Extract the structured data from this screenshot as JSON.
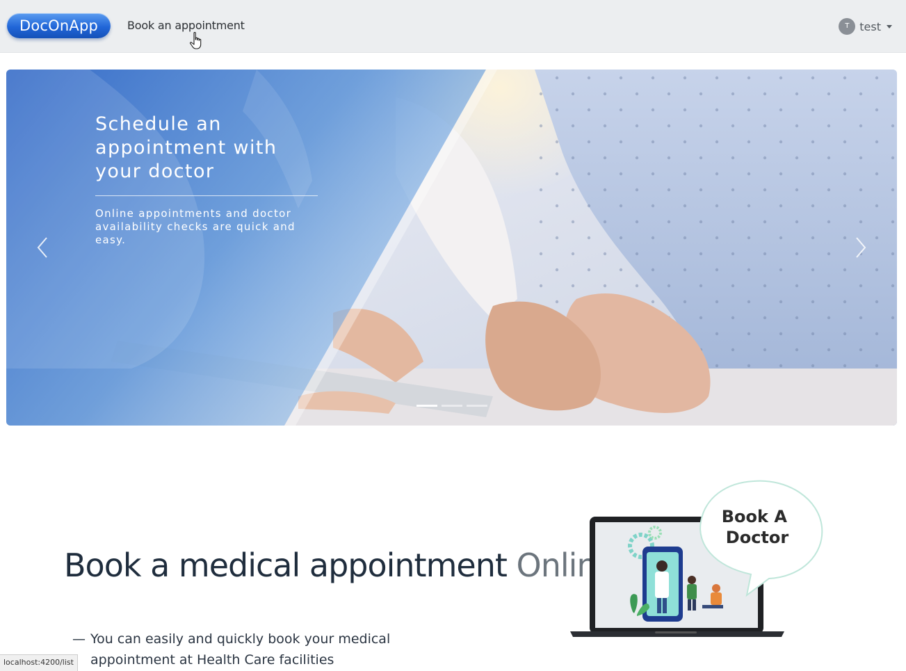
{
  "navbar": {
    "logo": "DocOnApp",
    "link": "Book an appointment",
    "user": {
      "avatar_initial": "T",
      "name": "test"
    }
  },
  "carousel": {
    "slide_count": 3,
    "active_index": 0,
    "slide": {
      "title": "Schedule an appointment with your doctor",
      "text": "Online appointments and doctor availability checks are quick and easy."
    },
    "prev_icon": "chevron-left-icon",
    "next_icon": "chevron-right-icon"
  },
  "hero": {
    "title_main": "Book a medical appointment",
    "title_accent": "Online.",
    "dash": "—",
    "subtitle": "You can easily and quickly book your medical appointment at Health Care facilities",
    "illustration_text": "Book A Doctor"
  },
  "status_bar": {
    "url": "localhost:4200/list"
  },
  "colors": {
    "navbar_bg": "#eceef0",
    "logo_blue": "#2166d8",
    "slide_overlay": "#3f7ad0",
    "hero_text": "#1f2d3d",
    "accent_gray": "#6c757d"
  }
}
